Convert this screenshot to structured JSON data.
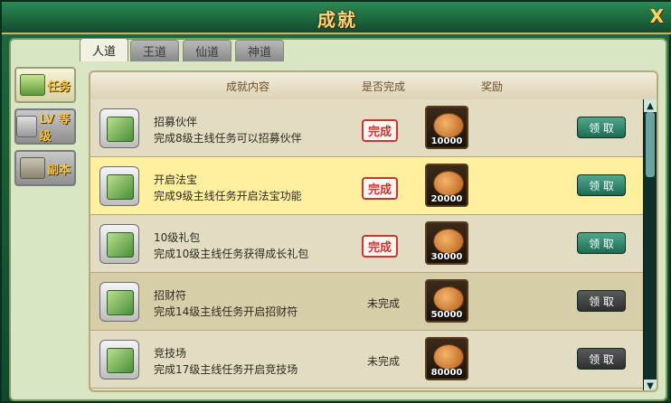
{
  "window": {
    "title": "成就",
    "close_label": "X"
  },
  "side_tabs": [
    {
      "label": "任务",
      "active": true,
      "icon": "scroll-icon"
    },
    {
      "label": "LV 等级",
      "active": false,
      "icon": "level-icon"
    },
    {
      "label": "副本",
      "active": false,
      "icon": "dungeon-icon"
    }
  ],
  "top_tabs": [
    {
      "label": "人道",
      "active": true
    },
    {
      "label": "王道",
      "active": false
    },
    {
      "label": "仙道",
      "active": false
    },
    {
      "label": "神道",
      "active": false
    }
  ],
  "table_headers": {
    "content": "成就内容",
    "status": "是否完成",
    "reward": "奖励"
  },
  "rows": [
    {
      "name": "招募伙伴",
      "desc": "完成8级主线任务可以招募伙伴",
      "status": "完成",
      "status_type": "stamp",
      "reward_amount": "10000",
      "claim_label": "领 取",
      "claim_enabled": true,
      "row_bg": "#e2dcc2"
    },
    {
      "name": "开启法宝",
      "desc": "完成9级主线任务开启法宝功能",
      "status": "完成",
      "status_type": "stamp",
      "reward_amount": "20000",
      "claim_label": "领 取",
      "claim_enabled": true,
      "row_bg": "#fff0a0"
    },
    {
      "name": "10级礼包",
      "desc": "完成10级主线任务获得成长礼包",
      "status": "完成",
      "status_type": "stamp",
      "reward_amount": "30000",
      "claim_label": "领 取",
      "claim_enabled": true,
      "row_bg": "#e2dcc2"
    },
    {
      "name": "招财符",
      "desc": "完成14级主线任务开启招财符",
      "status": "未完成",
      "status_type": "text",
      "reward_amount": "50000",
      "claim_label": "领 取",
      "claim_enabled": false,
      "row_bg": "#d6cda9"
    },
    {
      "name": "竞技场",
      "desc": "完成17级主线任务开启竞技场",
      "status": "未完成",
      "status_type": "text",
      "reward_amount": "80000",
      "claim_label": "领 取",
      "claim_enabled": false,
      "row_bg": "#e2dcc2"
    }
  ],
  "colors": {
    "accent": "#1c6b55",
    "disabled": "#2f2f2f",
    "highlight_row": "#fff0a0",
    "stamp_red": "#cc3333"
  }
}
